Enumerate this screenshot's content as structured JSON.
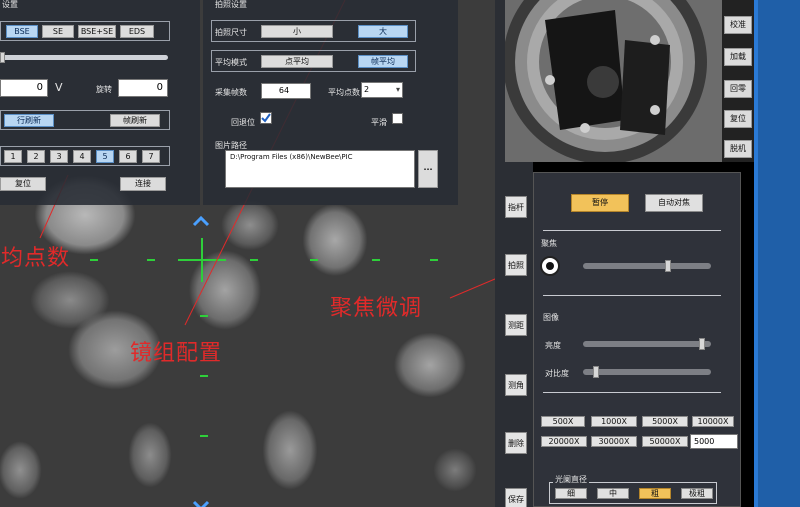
{
  "scan_settings": {
    "title": "设置",
    "detectors": [
      "BSE",
      "SE",
      "BSE+SE",
      "EDS"
    ],
    "selected_detector": 0,
    "voltage_value": "0",
    "voltage_unit": "V",
    "rotate_label": "旋转",
    "rotate_value": "0",
    "refresh_modes": [
      "行刷新",
      "帧刷新"
    ],
    "selected_refresh": 0,
    "speed_levels": [
      "1",
      "2",
      "3",
      "4",
      "5",
      "6",
      "7"
    ],
    "selected_speed": 4,
    "reset_label": "复位",
    "connect_label": "连接"
  },
  "capture_settings": {
    "title": "拍照设置",
    "size_label": "拍照尺寸",
    "size_options": [
      "小",
      "大"
    ],
    "selected_size": 1,
    "avg_mode_label": "平均模式",
    "avg_mode_options": [
      "点平均",
      "帧平均"
    ],
    "selected_avg_mode": 1,
    "frames_label": "采集帧数",
    "frames_value": "64",
    "avg_points_label": "平均点数",
    "avg_points_value": "2",
    "return_label": "回退位",
    "smooth_label": "平滑",
    "path_label": "图片路径",
    "path_value": "D:\\Program Files (x86)\\NewBee\\PIC",
    "browse_label": "..."
  },
  "camera_buttons": [
    "校准",
    "加载",
    "回零",
    "复位",
    "脱机"
  ],
  "left_tools": [
    "指杆",
    "拍照",
    "测距",
    "测角",
    "删除",
    "保存"
  ],
  "control_panel": {
    "pause_label": "暂停",
    "autofocus_label": "自动对焦",
    "focus_label": "聚焦",
    "focus_value": 0.67,
    "image_label": "图像",
    "brightness_label": "亮度",
    "brightness_value": 0.95,
    "contrast_label": "对比度",
    "contrast_value": 0.08,
    "magnifications": [
      "500X",
      "1000X",
      "5000X",
      "10000X",
      "20000X",
      "30000X",
      "50000X"
    ],
    "mag_input_value": "5000",
    "aperture_label": "光阑直径",
    "apertures": [
      "细",
      "中",
      "粗",
      "极粗"
    ],
    "selected_aperture": 2
  },
  "annotations": {
    "avg_points": "平均点数",
    "focus_tune": "聚焦微调",
    "lens_config": "镜组配置"
  },
  "colors": {
    "accent": "#f2c25a",
    "annotation": "#e02a2a",
    "crosshair": "#2ecf3a",
    "selected": "#b8d6f2"
  }
}
